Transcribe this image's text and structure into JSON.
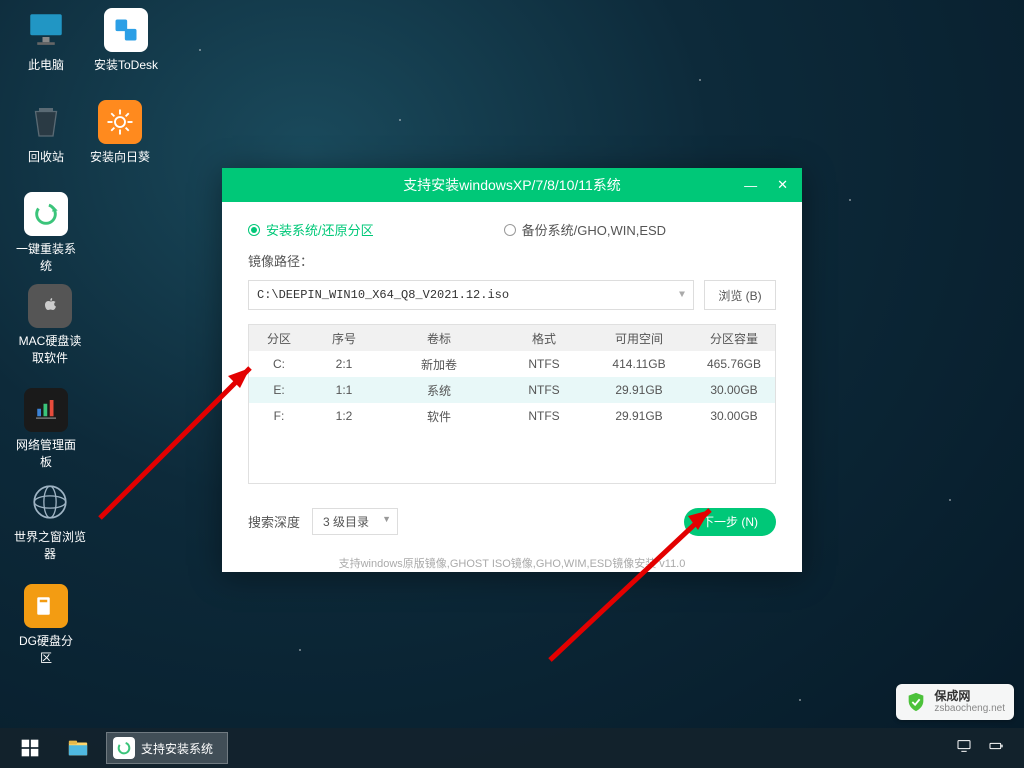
{
  "desktop": {
    "icons": [
      {
        "label": "此电脑"
      },
      {
        "label": "安装ToDesk"
      },
      {
        "label": "回收站"
      },
      {
        "label": "安装向日葵"
      },
      {
        "label": "一键重装系统"
      },
      {
        "label": "MAC硬盘读取软件"
      },
      {
        "label": "网络管理面板"
      },
      {
        "label": "世界之窗浏览器"
      },
      {
        "label": "DG硬盘分区"
      }
    ]
  },
  "dialog": {
    "title": "支持安装windowsXP/7/8/10/11系统",
    "radio_install": "安装系统/还原分区",
    "radio_backup": "备份系统/GHO,WIN,ESD",
    "image_path_label": "镜像路径：",
    "image_path_value": "C:\\DEEPIN_WIN10_X64_Q8_V2021.12.iso",
    "browse_label": "浏览 (B)",
    "table": {
      "headers": {
        "part": "分区",
        "seq": "序号",
        "vol": "卷标",
        "fmt": "格式",
        "free": "可用空间",
        "cap": "分区容量"
      },
      "rows": [
        {
          "part": "C:",
          "seq": "2:1",
          "vol": "新加卷",
          "fmt": "NTFS",
          "free": "414.11GB",
          "cap": "465.76GB"
        },
        {
          "part": "E:",
          "seq": "1:1",
          "vol": "系统",
          "fmt": "NTFS",
          "free": "29.91GB",
          "cap": "30.00GB"
        },
        {
          "part": "F:",
          "seq": "1:2",
          "vol": "软件",
          "fmt": "NTFS",
          "free": "29.91GB",
          "cap": "30.00GB"
        }
      ]
    },
    "search_depth_label": "搜索深度",
    "search_depth_value": "3 级目录",
    "next_label": "下一步 (N)",
    "footer": "支持windows原版镜像,GHOST ISO镜像,GHO,WIM,ESD镜像安装 v11.0"
  },
  "taskbar": {
    "running_label": "支持安装系统"
  },
  "watermark": {
    "line1": "保成网",
    "line2": "zsbaocheng.net"
  }
}
